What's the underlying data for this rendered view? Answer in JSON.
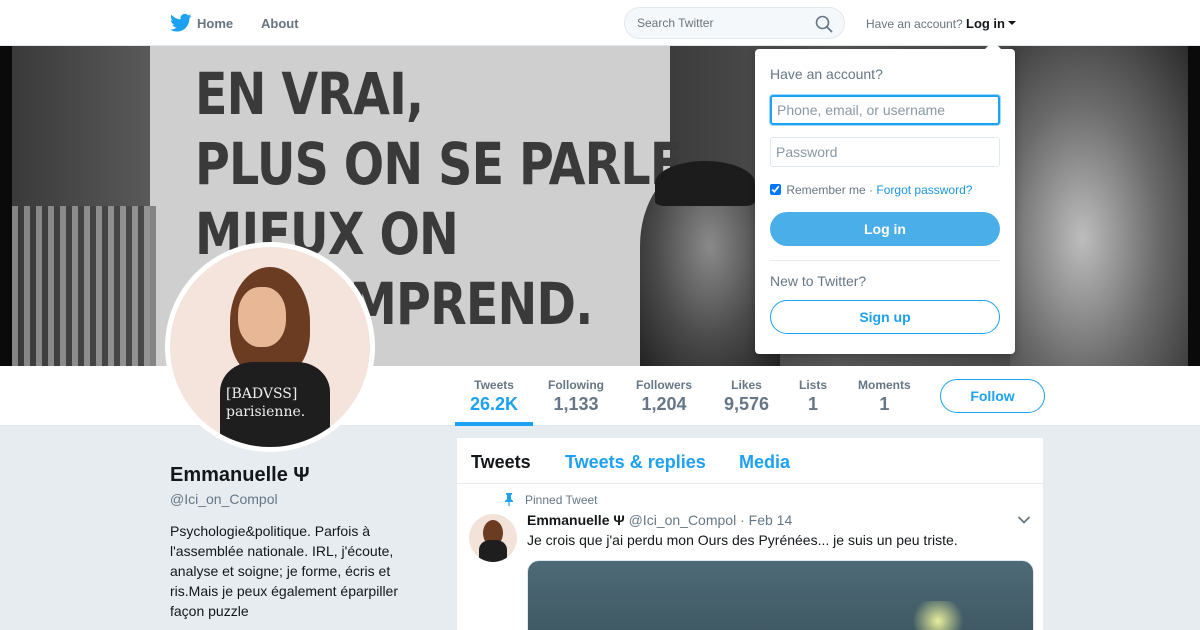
{
  "nav": {
    "home_label": "Home",
    "about_label": "About",
    "search_placeholder": "Search Twitter",
    "have_account": "Have an account?",
    "login_label": "Log in",
    "brand_color": "#1da1f2"
  },
  "banner": {
    "text_lines": [
      "EN VRAI,",
      "PLUS ON SE PARLE,",
      "MIEUX ON",
      "SE COMPREND."
    ]
  },
  "profile": {
    "name": "Emmanuelle Ψ",
    "handle": "@Ici_on_Compol",
    "bio": "Psychologie&politique. Parfois à l'assemblée nationale. IRL, j'écoute, analyse et soigne; je forme, écris et ris.Mais je peux également éparpiller façon puzzle",
    "avatar_shirt_text_1": "[BADVSS]",
    "avatar_shirt_text_2": "parisienne."
  },
  "stats": [
    {
      "label": "Tweets",
      "value": "26.2K"
    },
    {
      "label": "Following",
      "value": "1,133"
    },
    {
      "label": "Followers",
      "value": "1,204"
    },
    {
      "label": "Likes",
      "value": "9,576"
    },
    {
      "label": "Lists",
      "value": "1"
    },
    {
      "label": "Moments",
      "value": "1"
    }
  ],
  "follow_label": "Follow",
  "timeline": {
    "tabs": [
      "Tweets",
      "Tweets & replies",
      "Media"
    ],
    "active_tab": "Tweets",
    "pinned_label": "Pinned Tweet",
    "tweet": {
      "name": "Emmanuelle Ψ",
      "handle": "@Ici_on_Compol",
      "dot": "·",
      "date": "Feb 14",
      "text": "Je crois que j'ai perdu mon Ours des Pyrénées... je suis un peu triste."
    }
  },
  "login_dropdown": {
    "title": "Have an account?",
    "username_placeholder": "Phone, email, or username",
    "password_placeholder": "Password",
    "remember_label": "Remember me",
    "separator": "·",
    "forgot_label": "Forgot password?",
    "login_button": "Log in",
    "new_label": "New to Twitter?",
    "signup_button": "Sign up",
    "remember_checked": true
  }
}
